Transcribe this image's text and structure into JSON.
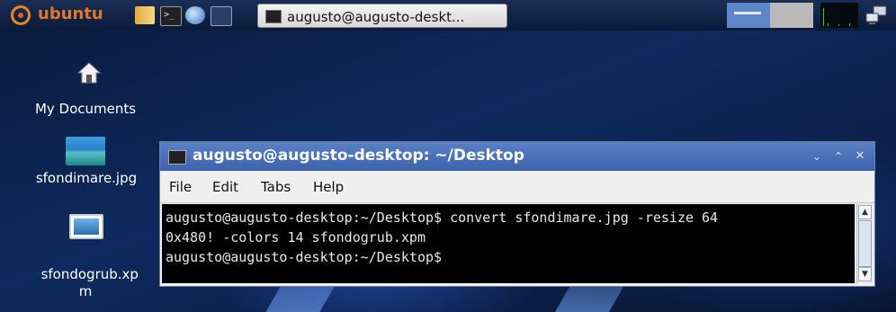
{
  "panel": {
    "brand": "ubuntu",
    "task_label": "augusto@augusto-deskt..."
  },
  "desktop": {
    "icons": [
      {
        "label": "My Documents"
      },
      {
        "label": "sfondimare.jpg"
      },
      {
        "label": "sfondogrub.xp\nm"
      }
    ]
  },
  "window": {
    "title": "augusto@augusto-desktop: ~/Desktop",
    "menu": [
      {
        "label": "File"
      },
      {
        "label": "Edit"
      },
      {
        "label": "Tabs"
      },
      {
        "label": "Help"
      }
    ],
    "terminal_lines": [
      "augusto@augusto-desktop:~/Desktop$ convert sfondimare.jpg -resize 64",
      "0x480! -colors 14 sfondogrub.xpm",
      "augusto@augusto-desktop:~/Desktop$"
    ]
  },
  "colors": {
    "titlebar": "#4a71b8",
    "ubuntu_orange": "#e07a2a"
  }
}
